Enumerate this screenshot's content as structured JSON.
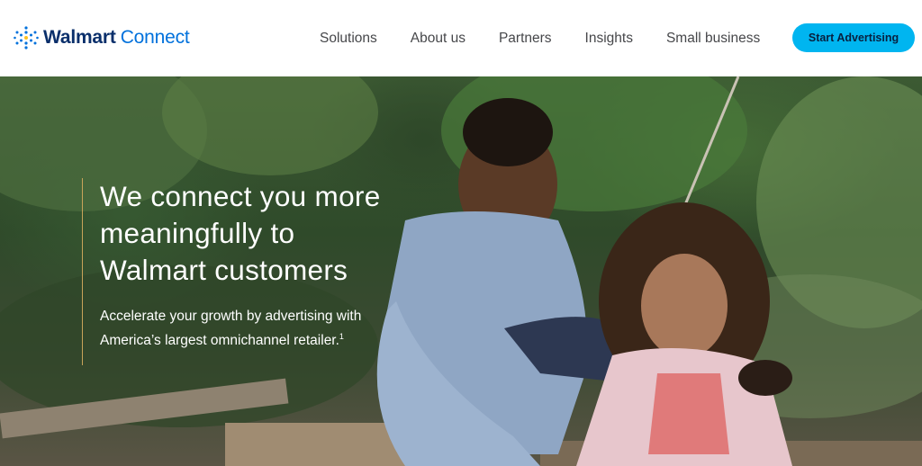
{
  "header": {
    "logo": {
      "brand": "Walmart",
      "product": "Connect",
      "icon": "walmart-spark-icon"
    },
    "nav": [
      {
        "label": "Solutions"
      },
      {
        "label": "About us"
      },
      {
        "label": "Partners"
      },
      {
        "label": "Insights"
      },
      {
        "label": "Small business"
      }
    ],
    "cta_label": "Start Advertising"
  },
  "hero": {
    "title_lines": [
      "We connect you more",
      "meaningfully to",
      "Walmart customers"
    ],
    "subtitle_line1": "Accelerate your growth by advertising with",
    "subtitle_line2": "America’s largest omnichannel retailer.",
    "footnote_mark": "1"
  },
  "colors": {
    "brand_navy": "#0a2f6b",
    "brand_blue": "#0071dc",
    "cta_bg": "#00b5f0",
    "accent_rule": "#c8a45a"
  }
}
